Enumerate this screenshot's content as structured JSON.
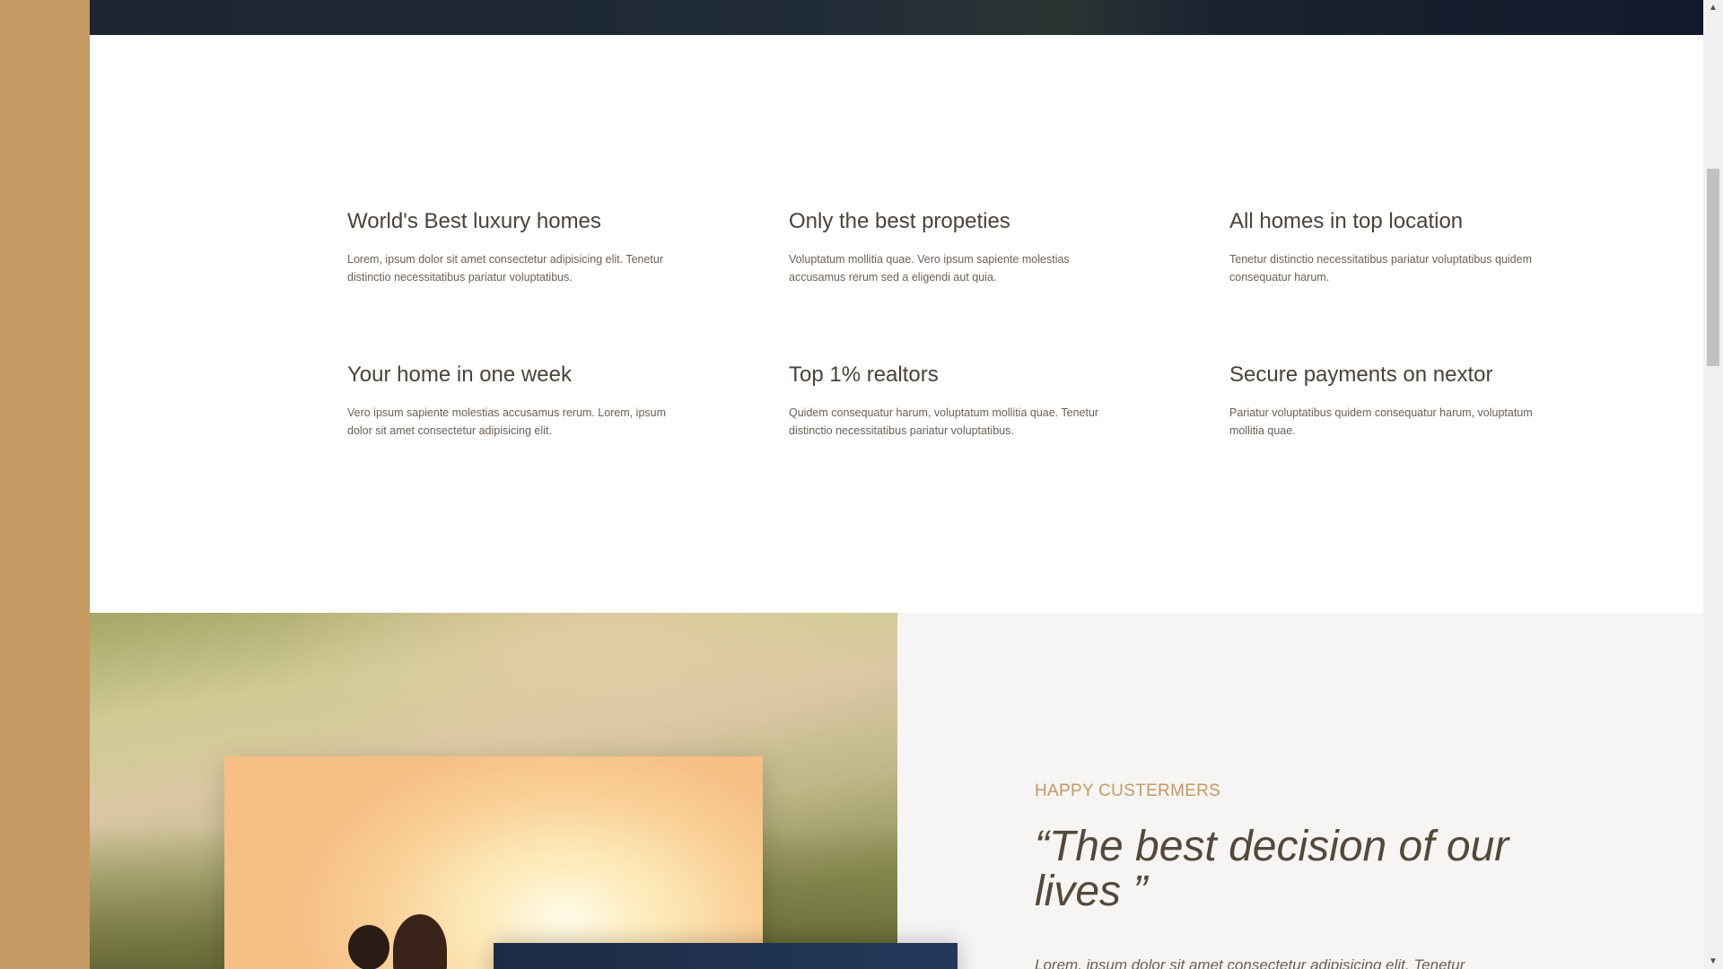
{
  "features": [
    {
      "title": "World's Best luxury homes",
      "text": "Lorem, ipsum dolor sit amet consectetur adipisicing elit. Tenetur distinctio necessitatibus pariatur voluptatibus."
    },
    {
      "title": "Only the best propeties",
      "text": "Voluptatum mollitia quae. Vero ipsum sapiente molestias accusamus rerum sed a eligendi aut quia."
    },
    {
      "title": "All homes in top location",
      "text": "Tenetur distinctio necessitatibus pariatur voluptatibus quidem consequatur harum."
    },
    {
      "title": "Your home in one week",
      "text": "Vero ipsum sapiente molestias accusamus rerum. Lorem, ipsum dolor sit amet consectetur adipisicing elit."
    },
    {
      "title": "Top 1% realtors",
      "text": "Quidem consequatur harum, voluptatum mollitia quae. Tenetur distinctio necessitatibus pariatur voluptatibus."
    },
    {
      "title": "Secure payments on nextor",
      "text": "Pariatur voluptatibus quidem consequatur harum, voluptatum mollitia quae."
    }
  ],
  "story": {
    "tag": "HAPPY CUSTERMERS",
    "quote": "“The best decision of our lives ”",
    "body": "Lorem, ipsum dolor sit amet consectetur adipisicing elit. Tenetur"
  },
  "colors": {
    "accent": "#c69963",
    "dark": "#101a2b",
    "text": "#54483a"
  },
  "icons": {
    "scroll_up": "triangle-up-icon",
    "scroll_down": "triangle-down-icon"
  }
}
